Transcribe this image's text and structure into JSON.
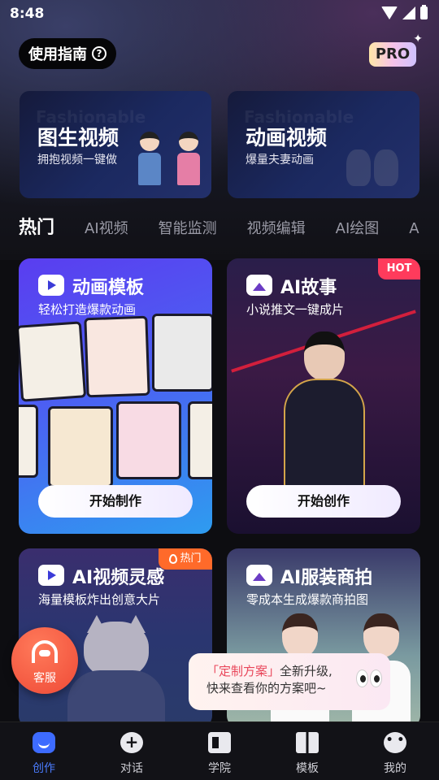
{
  "status_bar": {
    "time": "8:48"
  },
  "header": {
    "guide_label": "使用指南",
    "pro_label": "PRO"
  },
  "banners": [
    {
      "title": "图生视频",
      "subtitle": "拥抱视频一键做"
    },
    {
      "title": "动画视频",
      "subtitle": "爆量夫妻动画"
    }
  ],
  "tabs": [
    "热门",
    "AI视频",
    "智能监测",
    "视频编辑",
    "AI绘图",
    "A"
  ],
  "cards": [
    {
      "title": "动画模板",
      "subtitle": "轻松打造爆款动画",
      "button": "开始制作"
    },
    {
      "title": "AI故事",
      "subtitle": "小说推文一键成片",
      "button": "开始创作",
      "badge": "HOT"
    },
    {
      "title": "AI视频灵感",
      "subtitle": "海量模板炸出创意大片",
      "badge": "热门"
    },
    {
      "title": "AI服装商拍",
      "subtitle": "零成本生成爆款商拍图"
    }
  ],
  "service": {
    "label": "客服"
  },
  "promo": {
    "highlight": "「定制方案」",
    "line1_rest": "全新升级,",
    "line2": "快来查看你的方案吧~"
  },
  "nav": [
    {
      "label": "创作",
      "icon": "create-icon"
    },
    {
      "label": "对话",
      "icon": "chat-icon"
    },
    {
      "label": "学院",
      "icon": "school-icon"
    },
    {
      "label": "模板",
      "icon": "template-icon"
    },
    {
      "label": "我的",
      "icon": "profile-icon"
    }
  ],
  "colors": {
    "accent": "#3d6bff",
    "hot_red": "#ff3b5c",
    "hot_orange": "#ff6a2a",
    "service": "#ef4a36"
  }
}
